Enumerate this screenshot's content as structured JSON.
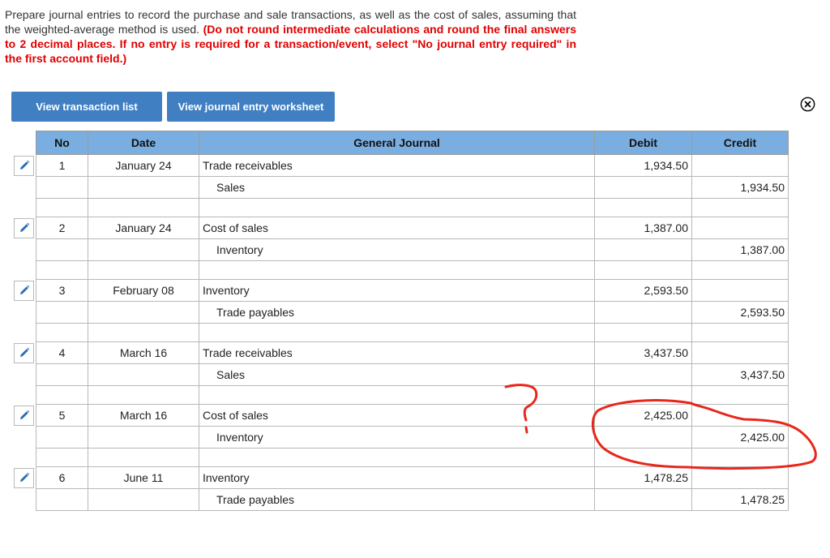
{
  "instructions": {
    "plain": "Prepare journal entries to record the purchase and sale transactions, as well as the cost of sales, assuming that the weighted-average method is used. ",
    "bold_red": "(Do not round intermediate calculations and round the final answers to 2 decimal places. If no entry is required for a transaction/event, select \"No journal entry required\" in the first account field.)"
  },
  "buttons": {
    "transaction_list": "View transaction list",
    "journal_worksheet": "View journal entry worksheet"
  },
  "table": {
    "headers": {
      "no": "No",
      "date": "Date",
      "account": "General Journal",
      "debit": "Debit",
      "credit": "Credit"
    },
    "entries": [
      {
        "no": "1",
        "date": "January 24",
        "debit_account": "Trade receivables",
        "credit_account": "Sales",
        "debit": "1,934.50",
        "credit": "1,934.50"
      },
      {
        "no": "2",
        "date": "January 24",
        "debit_account": "Cost of sales",
        "credit_account": "Inventory",
        "debit": "1,387.00",
        "credit": "1,387.00"
      },
      {
        "no": "3",
        "date": "February 08",
        "debit_account": "Inventory",
        "credit_account": "Trade payables",
        "debit": "2,593.50",
        "credit": "2,593.50"
      },
      {
        "no": "4",
        "date": "March 16",
        "debit_account": "Trade receivables",
        "credit_account": "Sales",
        "debit": "3,437.50",
        "credit": "3,437.50"
      },
      {
        "no": "5",
        "date": "March 16",
        "debit_account": "Cost of sales",
        "credit_account": "Inventory",
        "debit": "2,425.00",
        "credit": "2,425.00"
      },
      {
        "no": "6",
        "date": "June 11",
        "debit_account": "Inventory",
        "credit_account": "Trade payables",
        "debit": "1,478.25",
        "credit": "1,478.25"
      }
    ]
  },
  "icons": {
    "edit": "pencil-icon",
    "close": "close-circle-icon"
  },
  "colors": {
    "button": "#3f7fc2",
    "header": "#7aaee0",
    "instruction_red": "#e00000",
    "annotation": "#e8271c"
  }
}
